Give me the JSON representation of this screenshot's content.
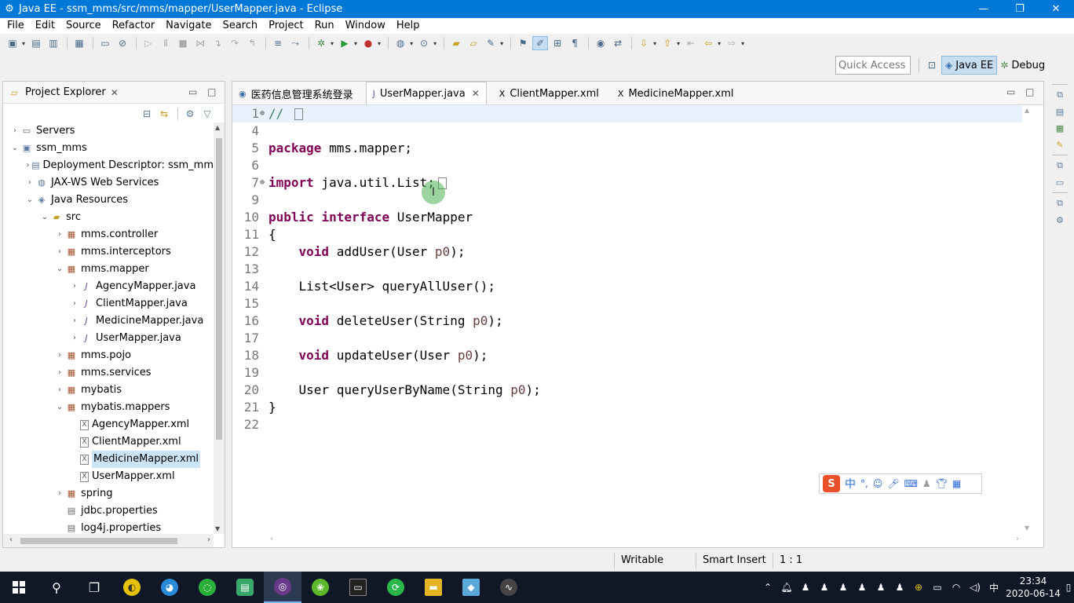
{
  "window": {
    "title": "Java EE - ssm_mms/src/mms/mapper/UserMapper.java - Eclipse",
    "minimize": "—",
    "restore": "❐",
    "close": "✕"
  },
  "menu": [
    "File",
    "Edit",
    "Source",
    "Refactor",
    "Navigate",
    "Search",
    "Project",
    "Run",
    "Window",
    "Help"
  ],
  "perspectives": {
    "quick_access_placeholder": "Quick Access",
    "items": [
      {
        "label": "Java EE",
        "active": true
      },
      {
        "label": "Debug",
        "active": false
      }
    ]
  },
  "project_explorer": {
    "title": "Project Explorer",
    "close": "✕",
    "tree": [
      {
        "label": "Servers",
        "depth": 0,
        "arrow": "›",
        "icon": "server-icon"
      },
      {
        "label": "ssm_mms",
        "depth": 0,
        "arrow": "⌄",
        "icon": "project-icon"
      },
      {
        "label": "Deployment Descriptor: ssm_mm",
        "depth": 1,
        "arrow": "›",
        "icon": "descriptor-icon"
      },
      {
        "label": "JAX-WS Web Services",
        "depth": 1,
        "arrow": "›",
        "icon": "webservice-icon"
      },
      {
        "label": "Java Resources",
        "depth": 1,
        "arrow": "⌄",
        "icon": "java-resources-icon"
      },
      {
        "label": "src",
        "depth": 2,
        "arrow": "⌄",
        "icon": "source-folder-icon"
      },
      {
        "label": "mms.controller",
        "depth": 3,
        "arrow": "›",
        "icon": "package-icon"
      },
      {
        "label": "mms.interceptors",
        "depth": 3,
        "arrow": "›",
        "icon": "package-icon"
      },
      {
        "label": "mms.mapper",
        "depth": 3,
        "arrow": "⌄",
        "icon": "package-icon"
      },
      {
        "label": "AgencyMapper.java",
        "depth": 4,
        "arrow": "›",
        "icon": "java-file-icon"
      },
      {
        "label": "ClientMapper.java",
        "depth": 4,
        "arrow": "›",
        "icon": "java-file-icon"
      },
      {
        "label": "MedicineMapper.java",
        "depth": 4,
        "arrow": "›",
        "icon": "java-file-icon"
      },
      {
        "label": "UserMapper.java",
        "depth": 4,
        "arrow": "›",
        "icon": "java-file-icon"
      },
      {
        "label": "mms.pojo",
        "depth": 3,
        "arrow": "›",
        "icon": "package-icon"
      },
      {
        "label": "mms.services",
        "depth": 3,
        "arrow": "›",
        "icon": "package-icon"
      },
      {
        "label": "mybatis",
        "depth": 3,
        "arrow": "›",
        "icon": "package-icon"
      },
      {
        "label": "mybatis.mappers",
        "depth": 3,
        "arrow": "⌄",
        "icon": "package-icon"
      },
      {
        "label": "AgencyMapper.xml",
        "depth": 4,
        "arrow": "",
        "icon": "xml-file-icon"
      },
      {
        "label": "ClientMapper.xml",
        "depth": 4,
        "arrow": "",
        "icon": "xml-file-icon"
      },
      {
        "label": "MedicineMapper.xml",
        "depth": 4,
        "arrow": "",
        "icon": "xml-file-icon",
        "selected": true
      },
      {
        "label": "UserMapper.xml",
        "depth": 4,
        "arrow": "",
        "icon": "xml-file-icon"
      },
      {
        "label": "spring",
        "depth": 3,
        "arrow": "›",
        "icon": "package-icon"
      },
      {
        "label": "jdbc.properties",
        "depth": 3,
        "arrow": "",
        "icon": "properties-file-icon"
      },
      {
        "label": "log4j.properties",
        "depth": 3,
        "arrow": "",
        "icon": "properties-file-icon"
      }
    ]
  },
  "editor": {
    "tabs": [
      {
        "label": "医药信息管理系统登录",
        "icon": "web-browser-icon",
        "active": false,
        "closable": false
      },
      {
        "label": "UserMapper.java",
        "icon": "java-file-icon",
        "active": true,
        "closable": true
      },
      {
        "label": "ClientMapper.xml",
        "icon": "xml-file-icon",
        "active": false,
        "closable": false
      },
      {
        "label": "MedicineMapper.xml",
        "icon": "xml-file-icon",
        "active": false,
        "closable": false
      }
    ],
    "lines": [
      {
        "num": "1",
        "fold": "⊕",
        "current": true,
        "tokens": [
          [
            "comment",
            "// "
          ]
        ],
        "folded": true
      },
      {
        "num": "4",
        "tokens": []
      },
      {
        "num": "5",
        "tokens": [
          [
            "kw",
            "package"
          ],
          [
            "plain",
            " mms.mapper;"
          ]
        ]
      },
      {
        "num": "6",
        "tokens": []
      },
      {
        "num": "7",
        "fold": "⊕",
        "tokens": [
          [
            "kw",
            "import"
          ],
          [
            "plain",
            " java.util.List;"
          ]
        ],
        "folded": true
      },
      {
        "num": "9",
        "tokens": []
      },
      {
        "num": "10",
        "tokens": [
          [
            "kw",
            "public"
          ],
          [
            "plain",
            " "
          ],
          [
            "kw",
            "interface"
          ],
          [
            "plain",
            " UserMapper"
          ]
        ]
      },
      {
        "num": "11",
        "tokens": [
          [
            "plain",
            "{"
          ]
        ]
      },
      {
        "num": "12",
        "tokens": [
          [
            "plain",
            "    "
          ],
          [
            "kw",
            "void"
          ],
          [
            "plain",
            " addUser(User "
          ],
          [
            "param",
            "p0"
          ],
          [
            "plain",
            ");"
          ]
        ]
      },
      {
        "num": "13",
        "tokens": []
      },
      {
        "num": "14",
        "tokens": [
          [
            "plain",
            "    List<User> queryAllUser();"
          ]
        ]
      },
      {
        "num": "15",
        "tokens": []
      },
      {
        "num": "16",
        "tokens": [
          [
            "plain",
            "    "
          ],
          [
            "kw",
            "void"
          ],
          [
            "plain",
            " deleteUser(String "
          ],
          [
            "param",
            "p0"
          ],
          [
            "plain",
            ");"
          ]
        ]
      },
      {
        "num": "17",
        "tokens": []
      },
      {
        "num": "18",
        "tokens": [
          [
            "plain",
            "    "
          ],
          [
            "kw",
            "void"
          ],
          [
            "plain",
            " updateUser(User "
          ],
          [
            "param",
            "p0"
          ],
          [
            "plain",
            ");"
          ]
        ]
      },
      {
        "num": "19",
        "tokens": []
      },
      {
        "num": "20",
        "tokens": [
          [
            "plain",
            "    User queryUserByName(String "
          ],
          [
            "param",
            "p0"
          ],
          [
            "plain",
            ");"
          ]
        ]
      },
      {
        "num": "21",
        "tokens": [
          [
            "plain",
            "}"
          ]
        ]
      },
      {
        "num": "22",
        "tokens": []
      }
    ]
  },
  "ime": {
    "logo": "S",
    "mode": "中"
  },
  "status": {
    "writable": "Writable",
    "insert_mode": "Smart Insert",
    "position": "1 : 1"
  },
  "taskbar": {
    "tray_lang": "中",
    "time": "23:34",
    "date": "2020-06-14"
  },
  "colors": {
    "keyword": "#7f0055",
    "comment": "#3f7f5f",
    "parameter": "#6a3e3e",
    "titlebar": "#0078d7",
    "selection": "#cce4f7"
  }
}
